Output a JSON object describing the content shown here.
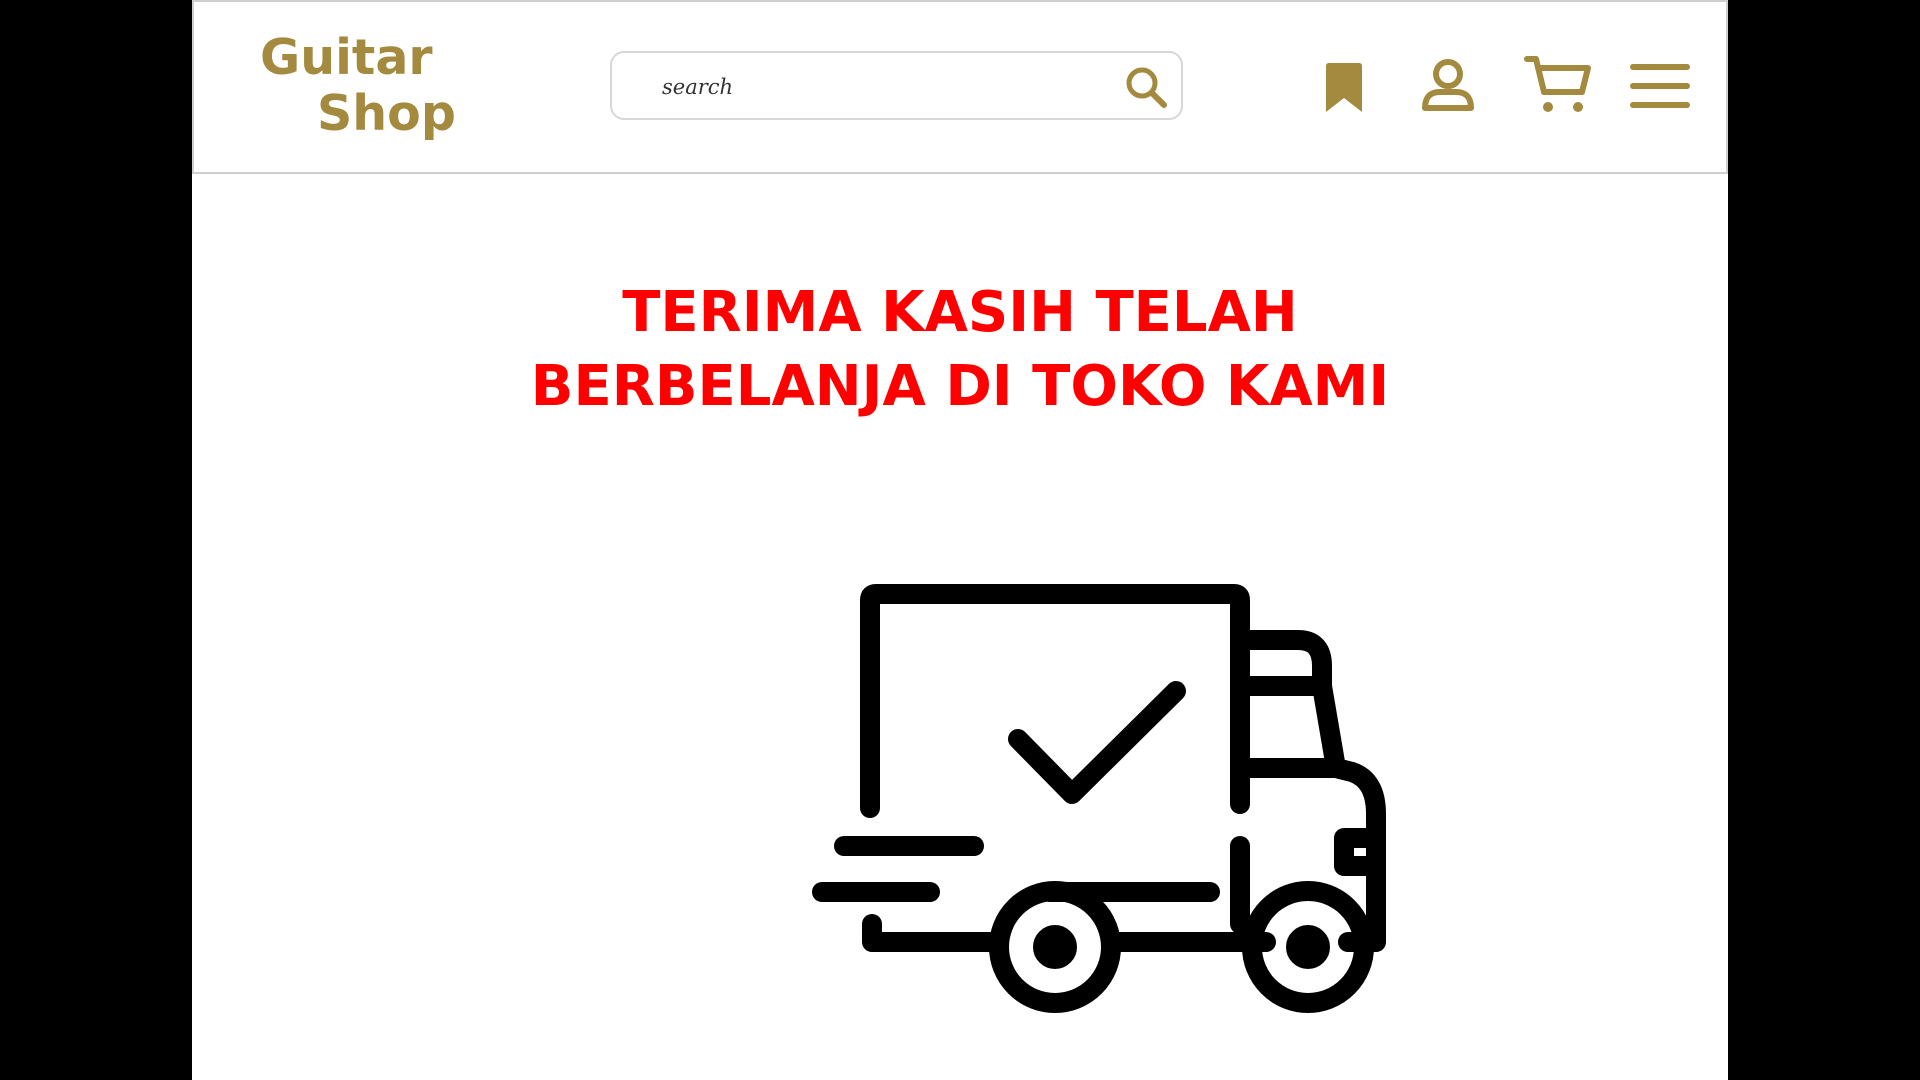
{
  "brand": {
    "line1": "Guitar",
    "line2": "Shop",
    "color": "#a38a3f"
  },
  "search": {
    "placeholder": "search"
  },
  "header_icons": [
    "search-icon",
    "bookmark-icon",
    "user-icon",
    "cart-icon",
    "menu-icon"
  ],
  "message": {
    "line1": "TERIMA KASIH TELAH",
    "line2": "BERBELANJA DI TOKO KAMI",
    "color": "#ff0000"
  },
  "illustration": {
    "icon": "delivery-truck-checkmark-icon"
  }
}
